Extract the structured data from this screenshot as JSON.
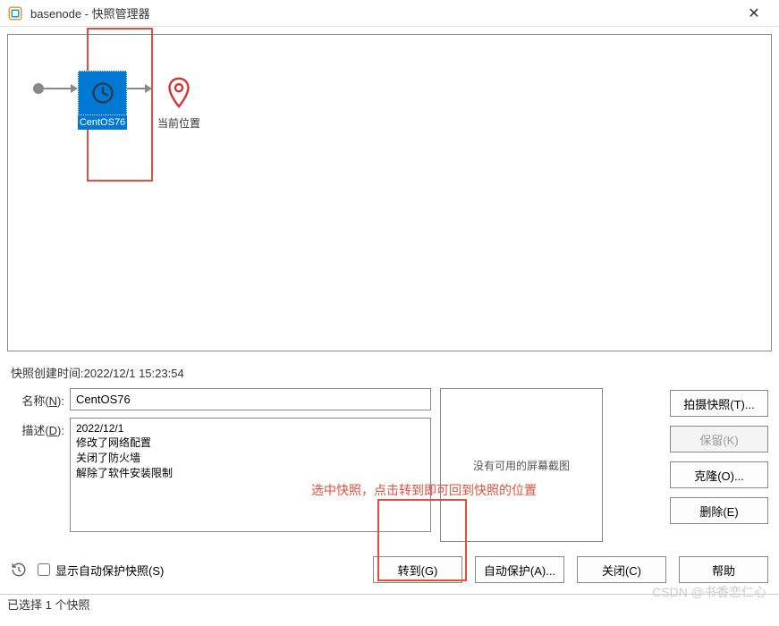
{
  "titlebar": {
    "title": "basenode - 快照管理器"
  },
  "tree": {
    "snapshot_name": "CentOS76",
    "current_label": "当前位置"
  },
  "details": {
    "create_time_label": "快照创建时间:",
    "create_time_value": "2022/12/1 15:23:54",
    "name_label_prefix": "名称(",
    "name_label_key": "N",
    "name_label_suffix": "):",
    "name_value": "CentOS76",
    "desc_label_prefix": "描述(",
    "desc_label_key": "D",
    "desc_label_suffix": "):",
    "desc_value": "2022/12/1\n修改了网络配置\n关闭了防火墙\n解除了软件安装限制",
    "screenshot_placeholder": "没有可用的屏幕截图"
  },
  "right_buttons": {
    "take_snapshot": "拍摄快照(T)...",
    "keep": "保留(K)",
    "clone": "克隆(O)...",
    "delete": "删除(E)"
  },
  "bottom": {
    "autoprotect_checkbox": "显示自动保护快照(S)",
    "goto": "转到(G)",
    "autoprotect_btn": "自动保护(A)...",
    "close": "关闭(C)",
    "help": "帮助"
  },
  "annotation": {
    "text": "选中快照，点击转到即可回到快照的位置"
  },
  "statusbar": {
    "text": "已选择 1 个快照"
  },
  "watermark": {
    "text": "CSDN @书香恋仁心"
  }
}
